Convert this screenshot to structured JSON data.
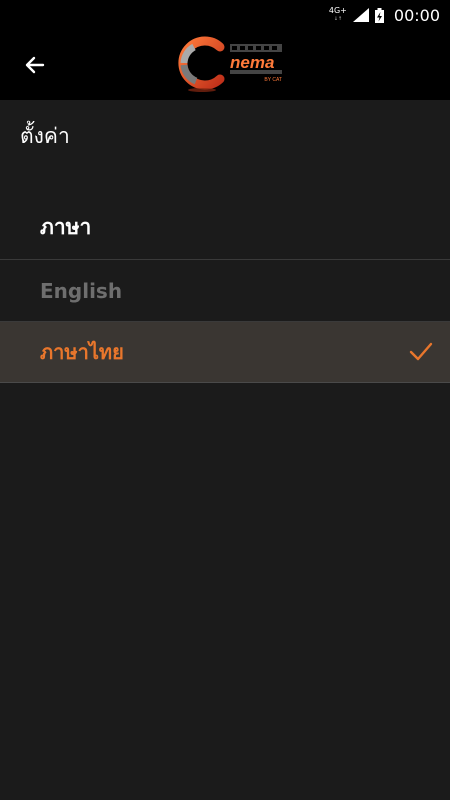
{
  "status_bar": {
    "network": "4G+",
    "network_sub": "↓↑",
    "time": "00:00"
  },
  "app_bar": {
    "back_icon": "arrow-left-icon",
    "logo_text": "nema",
    "logo_subtext": "BY CAT"
  },
  "page": {
    "title": "ตั้งค่า"
  },
  "language": {
    "header": "ภาษา",
    "options": [
      {
        "label": "English",
        "selected": false
      },
      {
        "label": "ภาษาไทย",
        "selected": true
      }
    ]
  },
  "colors": {
    "accent": "#e8762c",
    "background": "#1b1b1b",
    "appbar": "#000000",
    "selected_row": "#3a3632",
    "disabled_text": "#6e6e6e"
  }
}
